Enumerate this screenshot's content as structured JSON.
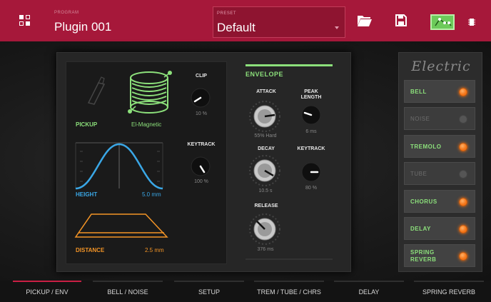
{
  "header": {
    "program_caption": "PROGRAM",
    "program_name": "Plugin 001",
    "preset_caption": "PRESET",
    "preset_name": "Default"
  },
  "pickup": {
    "label": "PICKUP",
    "value": "El-Magnetic",
    "height_label": "HEIGHT",
    "height_value": "5.0 mm",
    "distance_label": "DISTANCE",
    "distance_value": "2.5 mm",
    "clip_label": "CLIP",
    "clip_value": "10 %",
    "keytrack_label": "KEYTRACK",
    "keytrack_value": "100 %"
  },
  "envelope": {
    "title": "ENVELOPE",
    "attack_label": "ATTACK",
    "attack_value": "55% Hard",
    "peak_label_1": "PEAK",
    "peak_label_2": "LENGTH",
    "peak_value": "6 ms",
    "decay_label": "DECAY",
    "decay_value": "10.5 s",
    "keytrack_label": "KEYTRACK",
    "keytrack_value": "80 %",
    "release_label": "RELEASE",
    "release_value": "376 ms"
  },
  "effects": {
    "title": "Electric",
    "items": [
      {
        "label": "BELL",
        "on": true
      },
      {
        "label": "NOISE",
        "on": false
      },
      {
        "label": "TREMOLO",
        "on": true
      },
      {
        "label": "TUBE",
        "on": false
      },
      {
        "label": "CHORUS",
        "on": true
      },
      {
        "label": "DELAY",
        "on": true
      },
      {
        "label": "SPRING",
        "label2": "REVERB",
        "on": true
      }
    ]
  },
  "tabs": [
    {
      "label": "PICKUP / ENV",
      "active": true
    },
    {
      "label": "BELL / NOISE",
      "active": false
    },
    {
      "label": "SETUP",
      "active": false
    },
    {
      "label": "TREM / TUBE / CHRS",
      "active": false
    },
    {
      "label": "DELAY",
      "active": false
    },
    {
      "label": "SPRING REVERB",
      "active": false
    }
  ],
  "colors": {
    "header": "#a6183a",
    "accent_green": "#8ce07b",
    "accent_blue": "#3aa7e6",
    "accent_orange": "#f39426",
    "active_tab": "#c91f44"
  },
  "icons": [
    "grid-icon",
    "folder-icon",
    "save-icon",
    "envelope-view-icon",
    "chip-icon"
  ]
}
